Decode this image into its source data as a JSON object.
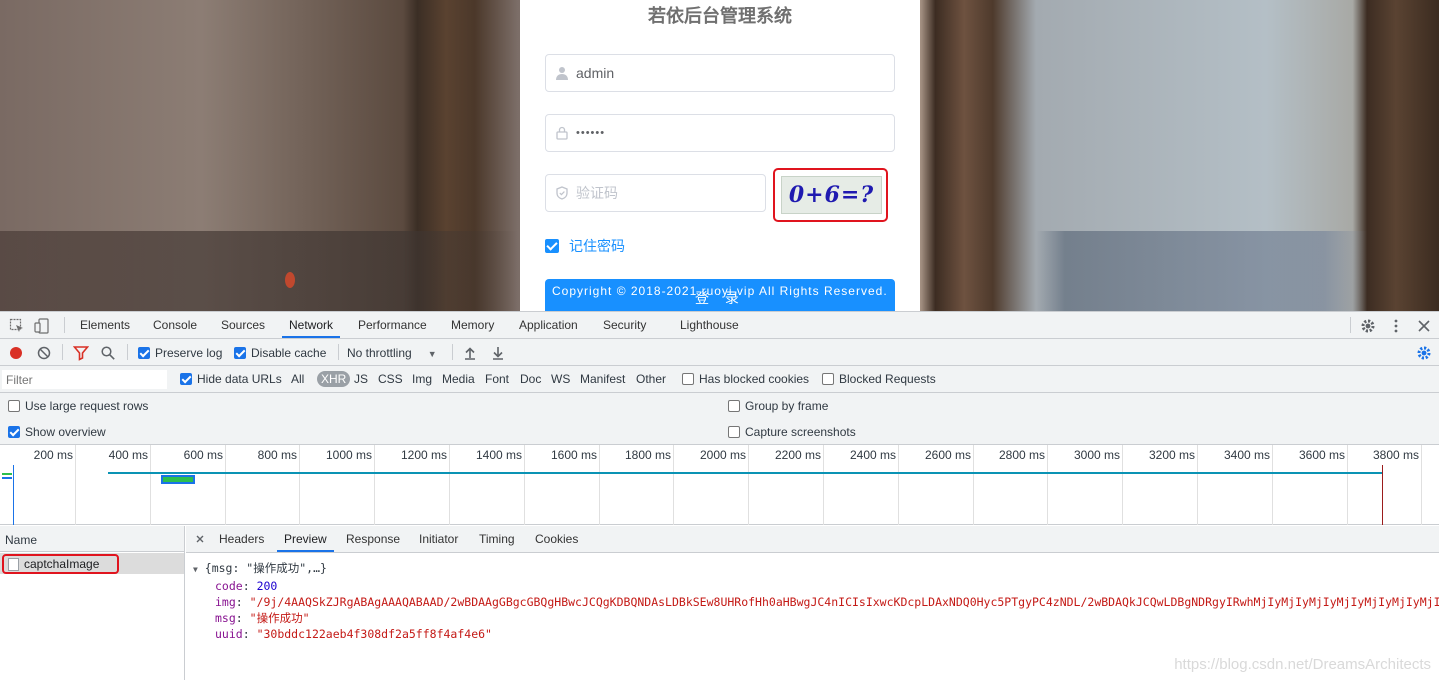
{
  "login": {
    "title": "若依后台管理系统",
    "username": "admin",
    "password": "••••••",
    "captcha_placeholder": "验证码",
    "captcha_text": "0+6=?",
    "remember_label": "记住密码",
    "login_button": "登 录",
    "copyright": "Copyright © 2018-2021 ruoyi.vip All Rights Reserved."
  },
  "devtools": {
    "tabs": [
      "Elements",
      "Console",
      "Sources",
      "Network",
      "Performance",
      "Memory",
      "Application",
      "Security",
      "Lighthouse"
    ],
    "active_tab": "Network",
    "toolbar": {
      "preserve_log": "Preserve log",
      "disable_cache": "Disable cache",
      "throttling": "No throttling"
    },
    "filter": {
      "placeholder": "Filter",
      "hide_data_urls": "Hide data URLs",
      "types": [
        "All",
        "XHR",
        "JS",
        "CSS",
        "Img",
        "Media",
        "Font",
        "Doc",
        "WS",
        "Manifest",
        "Other"
      ],
      "active_type": "XHR",
      "has_blocked_cookies": "Has blocked cookies",
      "blocked_requests": "Blocked Requests"
    },
    "options": {
      "large_rows": "Use large request rows",
      "group_by_frame": "Group by frame",
      "show_overview": "Show overview",
      "capture_screenshots": "Capture screenshots"
    },
    "timeline_ticks": [
      "200 ms",
      "400 ms",
      "600 ms",
      "800 ms",
      "1000 ms",
      "1200 ms",
      "1400 ms",
      "1600 ms",
      "1800 ms",
      "2000 ms",
      "2200 ms",
      "2400 ms",
      "2600 ms",
      "2800 ms",
      "3000 ms",
      "3200 ms",
      "3400 ms",
      "3600 ms",
      "3800 ms"
    ],
    "name_header": "Name",
    "request_name": "captchaImage",
    "detail_tabs": [
      "Headers",
      "Preview",
      "Response",
      "Initiator",
      "Timing",
      "Cookies"
    ],
    "active_detail_tab": "Preview",
    "preview": {
      "summary": "{msg: \"操作成功\",…}",
      "code_key": "code",
      "code_value": "200",
      "img_key": "img",
      "img_value": "\"/9j/4AAQSkZJRgABAgAAAQABAAD/2wBDAAgGBgcGBQgHBwcJCQgKDBQNDAsLDBkSEw8UHRofHh0aHBwgJC4nICIsIxwcKDcpLDAxNDQ0Hyc5PTgyPC4zNDL/2wBDAQkJCQwLDBgNDRgyIRwhMjIyMjIyMjIyMjIyMjIyMjIyMjIyMjIyMjIyMjIyMjIyMjIyMjIyMjIyMjIy",
      "msg_key": "msg",
      "msg_value": "\"操作成功\"",
      "uuid_key": "uuid",
      "uuid_value": "\"30bddc122aeb4f308df2a5ff8f4af4e6\""
    },
    "watermark": "https://blog.csdn.net/DreamsArchitects"
  }
}
